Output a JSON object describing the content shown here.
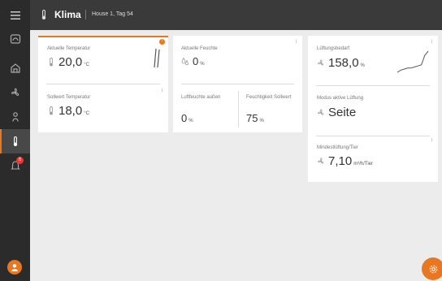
{
  "header": {
    "title": "Klima",
    "subtitle": "House 1, Tag 54"
  },
  "sidebar": {
    "items": [
      {
        "icon": "menu-icon"
      },
      {
        "icon": "dashboard-icon"
      },
      {
        "icon": "barn-icon"
      },
      {
        "icon": "fan-icon"
      },
      {
        "icon": "person-icon"
      },
      {
        "icon": "thermometer-icon"
      },
      {
        "icon": "alarm-icon"
      }
    ],
    "notification_count": "6"
  },
  "tiles": {
    "temp_current": {
      "label": "Aktuelle Temperatur",
      "value": "20,0",
      "unit": "°C"
    },
    "temp_target": {
      "label": "Sollwert Temperatur",
      "value": "18,0",
      "unit": "°C"
    },
    "humidity_current": {
      "label": "Aktuelle Feuchte",
      "value": "0",
      "unit": "%"
    },
    "humidity_outside": {
      "label": "Luftfeuchte außen",
      "value": "0",
      "unit": "%"
    },
    "humidity_target": {
      "label": "Feuchtigkeit Sollwert",
      "value": "75",
      "unit": "%"
    },
    "ventilation_demand": {
      "label": "Lüftungsbedarf",
      "value": "158,0",
      "unit": "%"
    },
    "ventilation_mode": {
      "label": "Modus aktive Lüftung",
      "value": "Seite"
    },
    "min_ventilation": {
      "label": "Mindestlüftung/Tier",
      "value": "7,10",
      "unit": "m³/h/Tier"
    }
  },
  "badges": {
    "temp_alert": "!"
  },
  "info_mark": "i",
  "colors": {
    "accent": "#e87722",
    "sidebar": "#2b2b2b",
    "topbar": "#3a3a3a"
  },
  "sparkline": {
    "ventilation_demand_trend": [
      0,
      2,
      3,
      4,
      4,
      5,
      6,
      7,
      16,
      20
    ]
  }
}
